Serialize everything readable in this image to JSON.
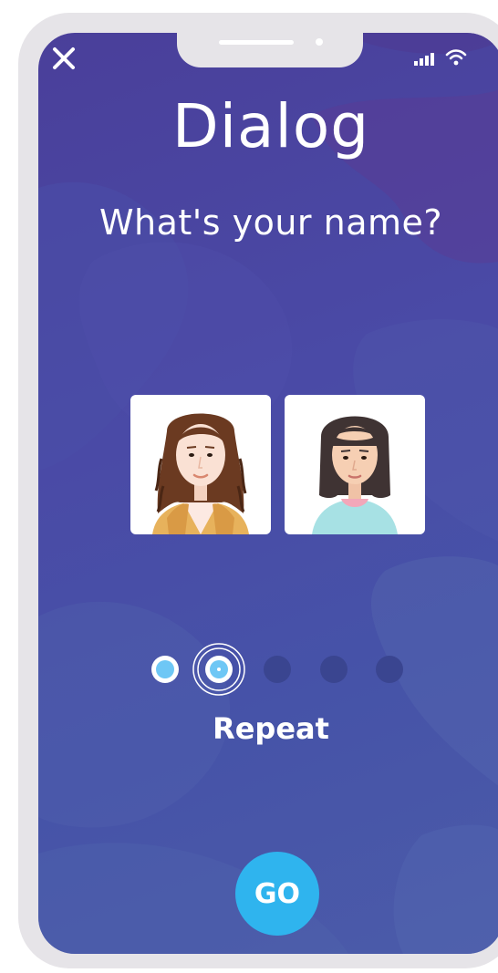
{
  "screen": {
    "title": "Dialog",
    "prompt": "What's your name?"
  },
  "avatars": [
    {
      "name": "woman-curly-hair",
      "selected": false
    },
    {
      "name": "woman-bob-hair",
      "selected": false
    }
  ],
  "progress": {
    "total_steps": 5,
    "completed_steps": 1,
    "current_step": 2
  },
  "actions": {
    "repeat_label": "Repeat",
    "go_label": "GO"
  },
  "icons": {
    "close": "close-icon",
    "signal": "signal-icon",
    "wifi": "wifi-icon"
  },
  "colors": {
    "background": "#4a4aa6",
    "accent": "#2fb4ee",
    "active_dot": "#6ec7f5",
    "inactive_dot": "#3a4590",
    "frame": "#e6e4e8"
  }
}
